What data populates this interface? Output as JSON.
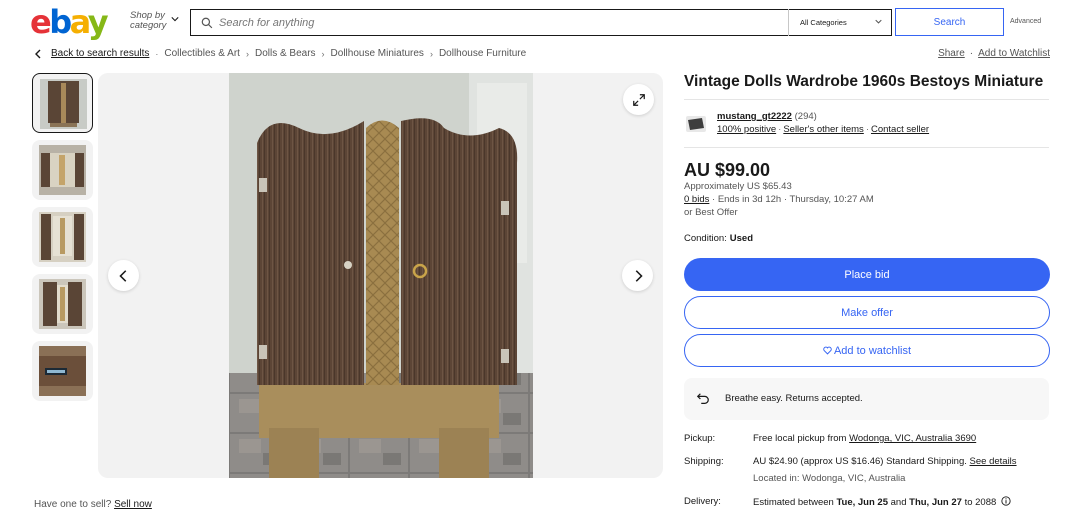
{
  "header": {
    "logo": {
      "e": "e",
      "b": "b",
      "a": "a",
      "y": "y"
    },
    "shop_by_line1": "Shop by",
    "shop_by_line2": "category",
    "search_placeholder": "Search for anything",
    "category_selected": "All Categories",
    "search_label": "Search",
    "advanced_label": "Advanced"
  },
  "breadcrumb": {
    "back": "Back to search results",
    "items": [
      "Collectibles & Art",
      "Dolls & Bears",
      "Dollhouse Miniatures",
      "Dollhouse Furniture"
    ]
  },
  "actions": {
    "share": "Share",
    "watchlist": "Add to Watchlist"
  },
  "gallery": {
    "thumbnail_count": 5,
    "active_index": 0
  },
  "sell": {
    "prompt": "Have one to sell?",
    "link": "Sell now"
  },
  "listing": {
    "title": "Vintage Dolls Wardrobe 1960s Bestoys Miniature",
    "seller": {
      "name": "mustang_gt2222",
      "feedback_count": "(294)",
      "positive": "100% positive",
      "other_items": "Seller's other items",
      "contact": "Contact seller"
    },
    "price": "AU $99.00",
    "approx": "Approximately US $65.43",
    "bids": "0 bids",
    "ends": "Ends in 3d 12h · Thursday, 10:27 AM",
    "best_offer": "or Best Offer",
    "condition_label": "Condition:",
    "condition_value": "Used",
    "buttons": {
      "place_bid": "Place bid",
      "make_offer": "Make offer",
      "add_watchlist": "Add to watchlist"
    },
    "returns_text": "Breathe easy. Returns accepted.",
    "pickup": {
      "label": "Pickup:",
      "text": "Free local pickup from",
      "location": "Wodonga, VIC, Australia 3690"
    },
    "shipping": {
      "label": "Shipping:",
      "text": "AU $24.90 (approx US $16.46) Standard Shipping.",
      "details_link": "See details",
      "located": "Located in: Wodonga, VIC, Australia"
    },
    "delivery": {
      "label": "Delivery:",
      "text": "Estimated between",
      "date1": "Tue, Jun 25",
      "and": "and",
      "date2": "Thu, Jun 27",
      "to": "to 2088"
    }
  },
  "colors": {
    "brand_blue": "#3665f3",
    "logo_red": "#e53238",
    "logo_blue": "#0064d2",
    "logo_yellow": "#f5af02",
    "logo_green": "#86b817"
  }
}
